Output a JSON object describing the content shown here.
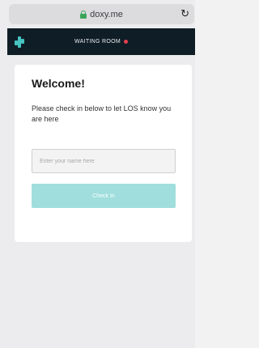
{
  "browser": {
    "url": "doxy.me",
    "lock_icon": "lock-icon",
    "reload_icon": "reload-icon",
    "reload_glyph": "↻"
  },
  "header": {
    "logo_icon": "doxy-logo-icon",
    "title": "WAITING ROOM",
    "status_color": "#e6404e"
  },
  "card": {
    "heading": "Welcome!",
    "message": "Please check in below to let LOS know you are here",
    "name_input": {
      "value": "",
      "placeholder": "Enter your name here"
    },
    "check_in_label": "Check In"
  },
  "colors": {
    "accent": "#45c3c0",
    "button": "#9fdedc",
    "header_bg": "#0f1d26"
  }
}
